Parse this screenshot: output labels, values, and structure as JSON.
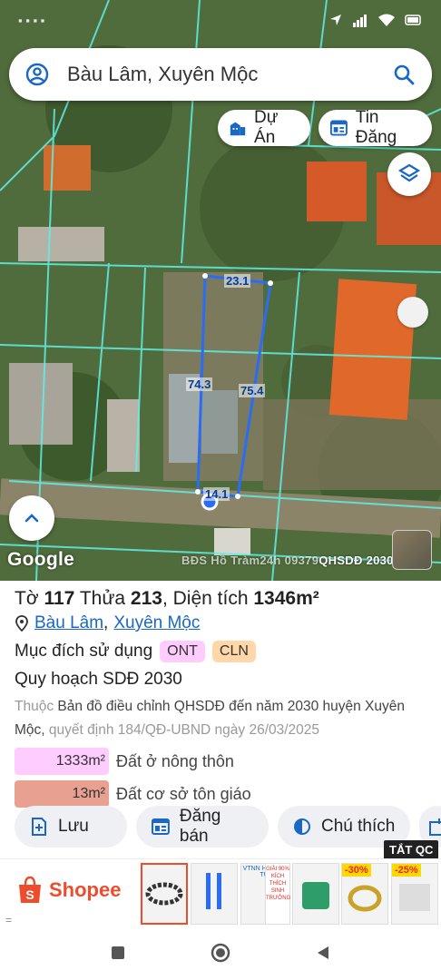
{
  "status_bar": {
    "left_text": "░░░"
  },
  "search": {
    "value": "Bàu Lâm, Xuyên Mộc",
    "icon_user": "user-circle-icon",
    "icon_search": "search-icon"
  },
  "chips": {
    "du_an": "Dự Án",
    "tin_dang": "Tin Đăng"
  },
  "map": {
    "dims": {
      "top": "23.1",
      "left": "74.3",
      "right": "75.4",
      "bottom": "14.1"
    },
    "google": "Google",
    "watermark": {
      "main": "BĐS Hồ Tràm24h 09379",
      "tail": "QHSDĐ 2030"
    }
  },
  "parcel": {
    "to_label": "Tờ",
    "to_value": "117",
    "thua_label": "Thửa",
    "thua_value": "213",
    "area_label": "Diện tích",
    "area_value": "1346m²",
    "location": {
      "commune": "Bàu Lâm",
      "district": "Xuyên Mộc",
      "separator": ","
    },
    "purpose_label": "Mục đích sử dụng",
    "purpose_tags": [
      "ONT",
      "CLN"
    ],
    "plan_title": "Quy hoạch SDĐ 2030",
    "desc_prefix": "Thuộc",
    "desc_main": "Bản đồ điều chỉnh QHSDĐ đến năm 2030 huyện Xuyên Mộc,",
    "desc_tail": "quyết định 184/QĐ-UBND ngày 26/03/2025",
    "legend": [
      {
        "area": "1333m²",
        "label": "Đất ở nông thôn",
        "color": "#ffccff"
      },
      {
        "area": "13m²",
        "label": "Đất cơ sở tôn giáo",
        "color": "#e8a090"
      }
    ]
  },
  "actions": {
    "save": "Lưu",
    "post_sale": "Đăng bán",
    "legend": "Chú thích"
  },
  "ad": {
    "close_label": "TẮT QC",
    "brand": "Shopee",
    "discounts": [
      "-30%",
      "-25%"
    ],
    "product_texts": [
      "GIẢI 90%",
      "KÍCH",
      "THÍCH",
      "SINH",
      "TRƯỞNG",
      "VTNN HOÀNG TÚ"
    ]
  },
  "colors": {
    "accent": "#1a67c4",
    "tag_ont": "#ffccff",
    "tag_cln": "#ffd7a8",
    "shopee": "#ee4d2d",
    "parcel_line": "#2a6df4"
  }
}
